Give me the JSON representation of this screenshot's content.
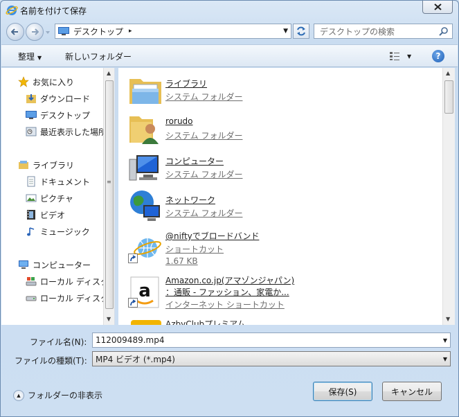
{
  "window": {
    "title": "名前を付けて保存"
  },
  "nav": {
    "address": "デスクトップ",
    "address_chevron": "▸",
    "search_placeholder": "デスクトップの検索"
  },
  "toolbar": {
    "organize": "整理",
    "new_folder": "新しいフォルダー"
  },
  "sidebar": {
    "favorites": {
      "label": "お気に入り",
      "items": [
        {
          "label": "ダウンロード",
          "icon": "download-folder-icon"
        },
        {
          "label": "デスクトップ",
          "icon": "desktop-icon"
        },
        {
          "label": "最近表示した場所",
          "icon": "recent-places-icon"
        }
      ]
    },
    "libraries": {
      "label": "ライブラリ",
      "items": [
        {
          "label": "ドキュメント",
          "icon": "documents-icon"
        },
        {
          "label": "ピクチャ",
          "icon": "pictures-icon"
        },
        {
          "label": "ビデオ",
          "icon": "video-icon"
        },
        {
          "label": "ミュージック",
          "icon": "music-icon"
        }
      ]
    },
    "computer": {
      "label": "コンピューター",
      "items": [
        {
          "label": "ローカル ディスク",
          "icon": "local-disk-icon"
        },
        {
          "label": "ローカル ディスク",
          "icon": "drive-icon"
        }
      ]
    }
  },
  "files": [
    {
      "name": "ライブラリ",
      "sub": "システム フォルダー",
      "icon": "library-folder-icon"
    },
    {
      "name": "rorudo",
      "sub": "システム フォルダー",
      "icon": "user-folder-icon"
    },
    {
      "name": "コンピューター",
      "sub": "システム フォルダー",
      "icon": "computer-icon"
    },
    {
      "name": "ネットワーク",
      "sub": "システム フォルダー",
      "icon": "network-icon"
    },
    {
      "name": "@niftyでブロードバンド",
      "sub": "ショートカット",
      "size": "1.67 KB",
      "icon": "internet-shortcut-icon"
    },
    {
      "name": "Amazon.co.jp(アマゾンジャパン)",
      "name2": "：通販 - ファッション、家電か...",
      "sub": "インターネット ショートカット",
      "icon": "amazon-shortcut-icon"
    },
    {
      "name": "AzbyClubプレミアム",
      "icon": "azby-shortcut-icon"
    }
  ],
  "form": {
    "filename_label": "ファイル名(N):",
    "filename_value": "112009489.mp4",
    "filetype_label": "ファイルの種類(T):",
    "filetype_value": "MP4 ビデオ (*.mp4)"
  },
  "footer": {
    "hide_folders": "フォルダーの非表示",
    "save": "保存(S)",
    "cancel": "キャンセル"
  }
}
